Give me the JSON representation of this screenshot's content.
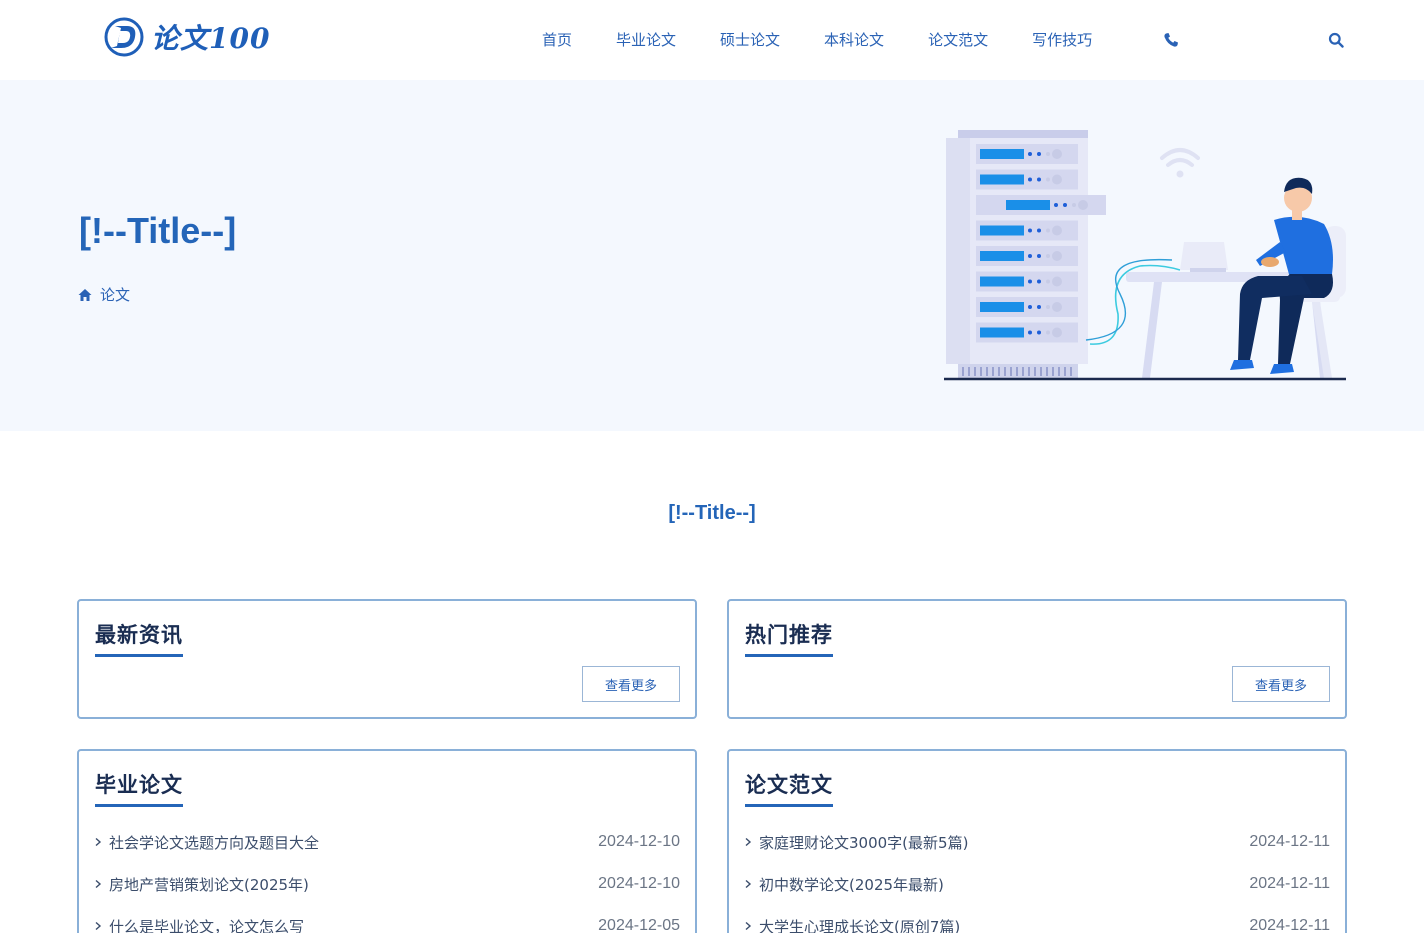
{
  "logo": {
    "text": "论文100"
  },
  "nav": {
    "items": [
      "首页",
      "毕业论文",
      "硕士论文",
      "本科论文",
      "论文范文",
      "写作技巧"
    ],
    "icons": [
      "phone-icon",
      "search-icon"
    ]
  },
  "hero": {
    "title": "[!--Title--]",
    "breadcrumb": "论文"
  },
  "section": {
    "title": "[!--Title--]"
  },
  "panels": {
    "latest": {
      "title": "最新资讯",
      "more": "查看更多"
    },
    "hot": {
      "title": "热门推荐",
      "more": "查看更多"
    },
    "graduation": {
      "title": "毕业论文",
      "items": [
        {
          "title": "社会学论文选题方向及题目大全",
          "date": "2024-12-10"
        },
        {
          "title": "房地产营销策划论文(2025年)",
          "date": "2024-12-10"
        },
        {
          "title": "什么是毕业论文，论文怎么写",
          "date": "2024-12-05"
        }
      ]
    },
    "samples": {
      "title": "论文范文",
      "items": [
        {
          "title": "家庭理财论文3000字(最新5篇)",
          "date": "2024-12-11"
        },
        {
          "title": "初中数学论文(2025年最新)",
          "date": "2024-12-11"
        },
        {
          "title": "大学生心理成长论文(原创7篇)",
          "date": "2024-12-11"
        }
      ]
    }
  },
  "colors": {
    "brand": "#2465b8",
    "heroBg": "#f4f8fe",
    "panelBorder": "#8ab0d8"
  }
}
